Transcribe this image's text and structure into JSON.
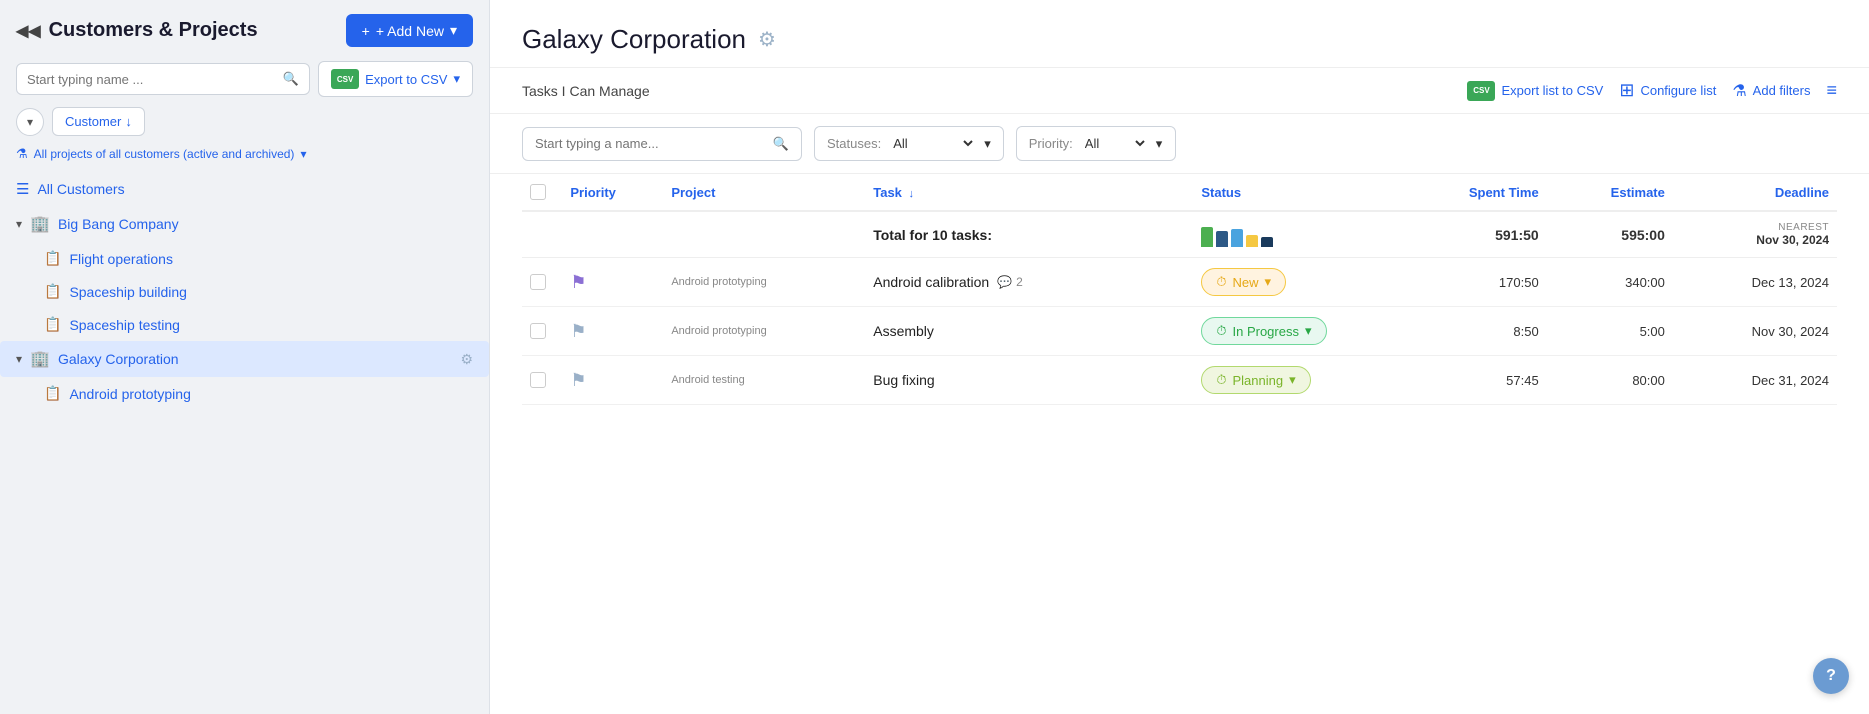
{
  "sidebar": {
    "title": "Customers & Projects",
    "add_new_label": "+ Add New",
    "add_new_dropdown": true,
    "search_placeholder": "Start typing name ...",
    "export_label": "Export to CSV",
    "customer_sort_label": "Customer",
    "project_filter_label": "All projects of all customers (active and archived)",
    "all_customers_label": "All Customers",
    "companies": [
      {
        "name": "Big Bang Company",
        "expanded": true,
        "projects": [
          {
            "name": "Flight operations"
          },
          {
            "name": "Spaceship building"
          },
          {
            "name": "Spaceship testing"
          }
        ]
      },
      {
        "name": "Galaxy Corporation",
        "expanded": true,
        "active": true,
        "projects": [
          {
            "name": "Android prototyping"
          }
        ]
      }
    ]
  },
  "main": {
    "title": "Galaxy Corporation",
    "section_label": "Tasks I Can Manage",
    "export_list_label": "Export list to CSV",
    "configure_list_label": "Configure list",
    "add_filters_label": "Add filters",
    "search_placeholder": "Start typing a name...",
    "statuses_label": "Statuses:",
    "statuses_value": "All",
    "priority_label": "Priority:",
    "priority_value": "All",
    "table": {
      "headers": {
        "priority": "Priority",
        "project": "Project",
        "task": "Task",
        "status": "Status",
        "spent_time": "Spent Time",
        "estimate": "Estimate",
        "deadline": "Deadline"
      },
      "total_row": {
        "label": "Total for 10 tasks:",
        "spent": "591:50",
        "estimate": "595:00",
        "deadline_label": "NEAREST",
        "deadline_value": "Nov 30, 2024"
      },
      "rows": [
        {
          "priority_flag": "purple",
          "project": "Android prototyping",
          "task_name": "Android calibration",
          "comments": "2",
          "status": "New",
          "status_type": "new",
          "spent_time": "170:50",
          "estimate": "340:00",
          "deadline": "Dec 13, 2024"
        },
        {
          "priority_flag": "gray",
          "project": "Android prototyping",
          "task_name": "Assembly",
          "comments": "",
          "status": "In Progress",
          "status_type": "inprogress",
          "spent_time": "8:50",
          "estimate": "5:00",
          "deadline": "Nov 30, 2024"
        },
        {
          "priority_flag": "gray",
          "project": "Android testing",
          "task_name": "Bug fixing",
          "comments": "",
          "status": "Planning",
          "status_type": "planning",
          "spent_time": "57:45",
          "estimate": "80:00",
          "deadline": "Dec 31, 2024"
        }
      ]
    }
  },
  "icons": {
    "search": "🔍",
    "gear": "⚙",
    "filter": "⚗",
    "caret_down": "▾",
    "caret_left": "◀",
    "list_view": "≡",
    "clock": "⏱",
    "chevron_down": "▾",
    "chevron_right": "▸",
    "flag": "⚑",
    "export": "📤",
    "configure": "⊞"
  },
  "colors": {
    "accent_blue": "#2563eb",
    "sidebar_bg": "#f0f2f5",
    "active_bg": "#dce8ff",
    "border": "#dde1e7"
  }
}
